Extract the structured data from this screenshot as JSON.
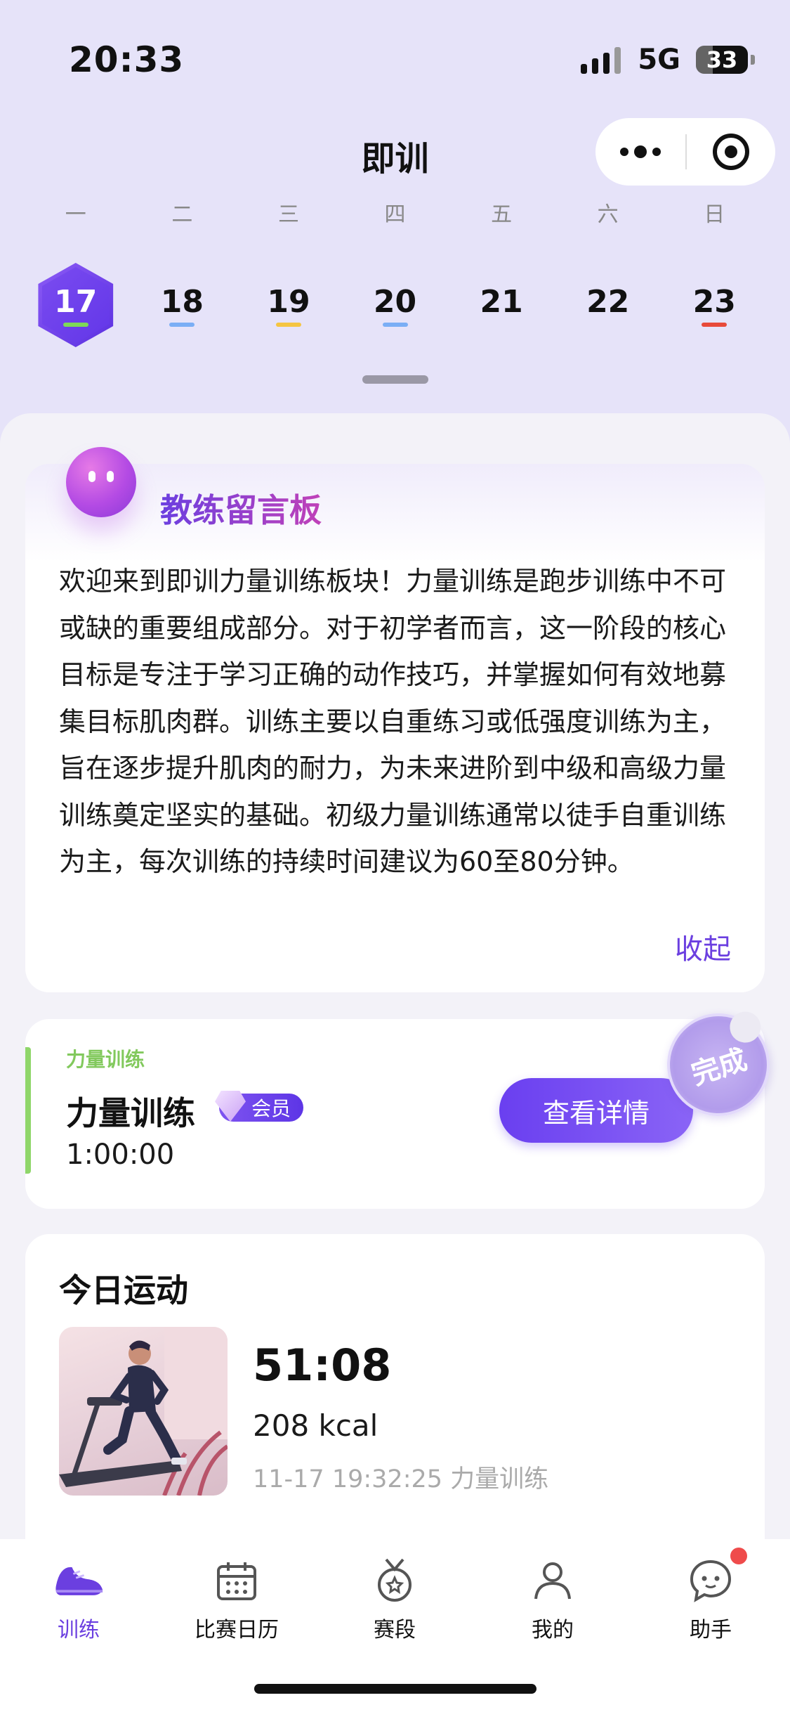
{
  "status_bar": {
    "time": "20:33",
    "network": "5G",
    "battery": "33",
    "battery_level": 0.33
  },
  "nav": {
    "title": "即训",
    "more_icon": "more-dots-icon",
    "target_icon": "target-icon"
  },
  "calendar": {
    "weekdays": [
      "一",
      "二",
      "三",
      "四",
      "五",
      "六",
      "日"
    ],
    "dates": [
      {
        "num": "17",
        "bar_color": "#7ed957",
        "active": true
      },
      {
        "num": "18",
        "bar_color": "#7aaef5"
      },
      {
        "num": "19",
        "bar_color": "#f5c542"
      },
      {
        "num": "20",
        "bar_color": "#7aaef5"
      },
      {
        "num": "21",
        "bar_color": ""
      },
      {
        "num": "22",
        "bar_color": ""
      },
      {
        "num": "23",
        "bar_color": "#e84a3a"
      }
    ]
  },
  "coach": {
    "title": "教练留言板",
    "message": "欢迎来到即训力量训练板块！力量训练是跑步训练中不可或缺的重要组成部分。对于初学者而言，这一阶段的核心目标是专注于学习正确的动作技巧，并掌握如何有效地募集目标肌肉群。训练主要以自重练习或低强度训练为主，旨在逐步提升肌肉的耐力，为未来进阶到中级和高级力量训练奠定坚实的基础。初级力量训练通常以徒手自重训练为主，每次训练的持续时间建议为60至80分钟。",
    "collapse_label": "收起"
  },
  "training": {
    "tag": "力量训练",
    "name": "力量训练",
    "badge": "会员",
    "duration": "1:00:00",
    "detail_button": "查看详情",
    "stamp_text": "完成"
  },
  "today": {
    "heading": "今日运动",
    "time": "51:08",
    "kcal": "208 kcal",
    "meta": "11-17 19:32:25 力量训练"
  },
  "tabbar": {
    "items": [
      {
        "label": "训练",
        "icon": "shoe-icon",
        "active": true
      },
      {
        "label": "比赛日历",
        "icon": "calendar-icon"
      },
      {
        "label": "赛段",
        "icon": "medal-icon"
      },
      {
        "label": "我的",
        "icon": "person-icon"
      },
      {
        "label": "助手",
        "icon": "assistant-chat-icon",
        "badge_dot": true
      }
    ]
  },
  "colors": {
    "accent": "#6b3fe0",
    "page_bg": "#e6e3f9",
    "sheet_bg": "#f3f2f8",
    "tag_green": "#82c95d"
  }
}
